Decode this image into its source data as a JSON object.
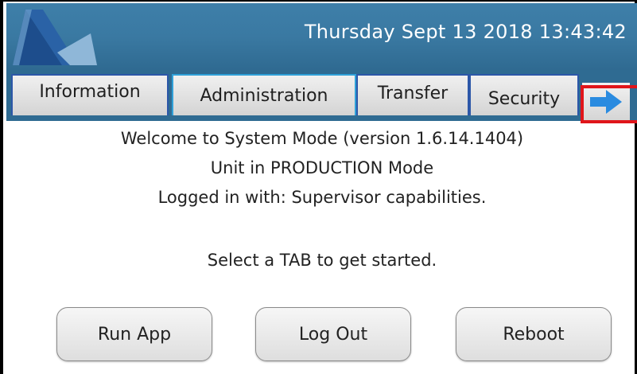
{
  "header": {
    "datetime": "Thursday Sept 13 2018 13:43:42",
    "logo_icon": "company-logo-icon"
  },
  "tabs": [
    {
      "label": "Information",
      "active": false
    },
    {
      "label": "Administration",
      "active": true
    },
    {
      "label": "Transfer",
      "active": false
    },
    {
      "label": "Security",
      "active": false
    }
  ],
  "next_tab_icon": "arrow-right-icon",
  "main": {
    "welcome": "Welcome to System Mode (version 1.6.14.1404)",
    "mode": "Unit in PRODUCTION Mode",
    "login": "Logged in with: Supervisor capabilities.",
    "prompt": "Select a TAB to get started."
  },
  "buttons": {
    "run_app": "Run App",
    "log_out": "Log Out",
    "reboot": "Reboot"
  },
  "colors": {
    "header_blue": "#3a79a2",
    "tab_border": "#2c57a8",
    "active_tab_border": "#2fa0d8",
    "arrow_blue": "#2a8be0",
    "highlight_red": "#e0151a"
  }
}
